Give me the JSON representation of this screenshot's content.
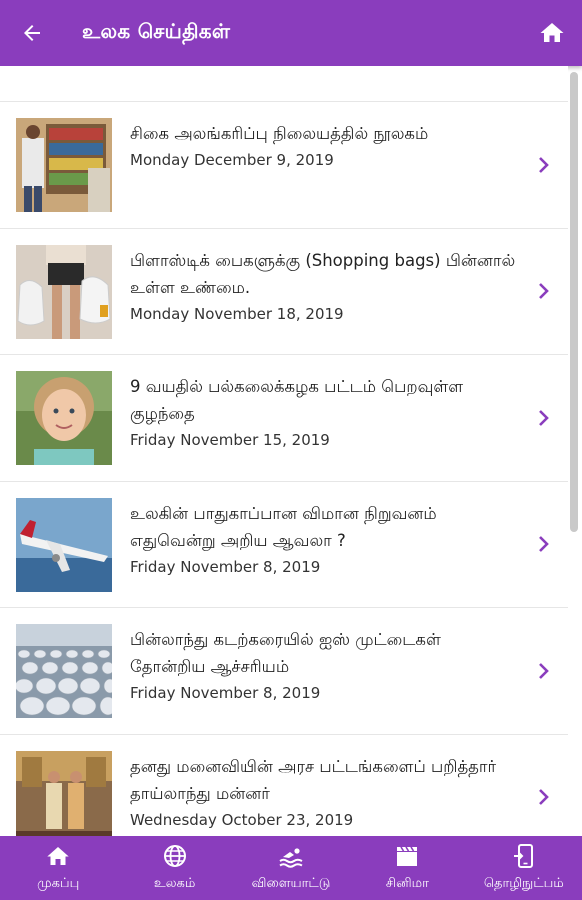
{
  "appbar": {
    "title": "உலக செய்திகள்",
    "back_icon": "arrow-left-icon",
    "home_icon": "home-icon",
    "color": "#8a3dbd"
  },
  "news": [
    {
      "title": "சிகை அலங்கரிப்பு நிலையத்தில் நூலகம்",
      "date": "Monday December 9, 2019",
      "image": "barber-library-photo"
    },
    {
      "title": "பிளாஸ்டிக் பைகளுக்கு (Shopping bags) பின்னால் உள்ள உண்மை.",
      "date": "Monday November 18, 2019",
      "image": "shopping-bags-photo"
    },
    {
      "title": "9 வயதில் பல்கலைக்கழக பட்டம் பெறவுள்ள குழந்தை",
      "date": "Friday November 15, 2019",
      "image": "child-portrait-photo"
    },
    {
      "title": "உலகின் பாதுகாப்பான விமான நிறுவனம் எதுவென்று அறிய ஆவலா ?",
      "date": "Friday November 8, 2019",
      "image": "airplane-photo"
    },
    {
      "title": "பின்லாந்து கடற்கரையில் ஐஸ் முட்டைகள் தோன்றிய ஆச்சரியம்",
      "date": "Friday November 8, 2019",
      "image": "ice-eggs-beach-photo"
    },
    {
      "title": "தனது மனைவியின் அரச பட்டங்களைப் பறித்தார் தாய்லாந்து மன்னர்",
      "date": "Wednesday October 23, 2019",
      "image": "thai-royals-photo"
    }
  ],
  "bottom_nav": [
    {
      "label": "முகப்பு",
      "icon": "home-icon"
    },
    {
      "label": "உலகம்",
      "icon": "globe-icon"
    },
    {
      "label": "விளையாட்டு",
      "icon": "swimmer-icon"
    },
    {
      "label": "சினிமா",
      "icon": "clapperboard-icon"
    },
    {
      "label": "தொழிநுட்பம்",
      "icon": "phone-tech-icon"
    }
  ]
}
